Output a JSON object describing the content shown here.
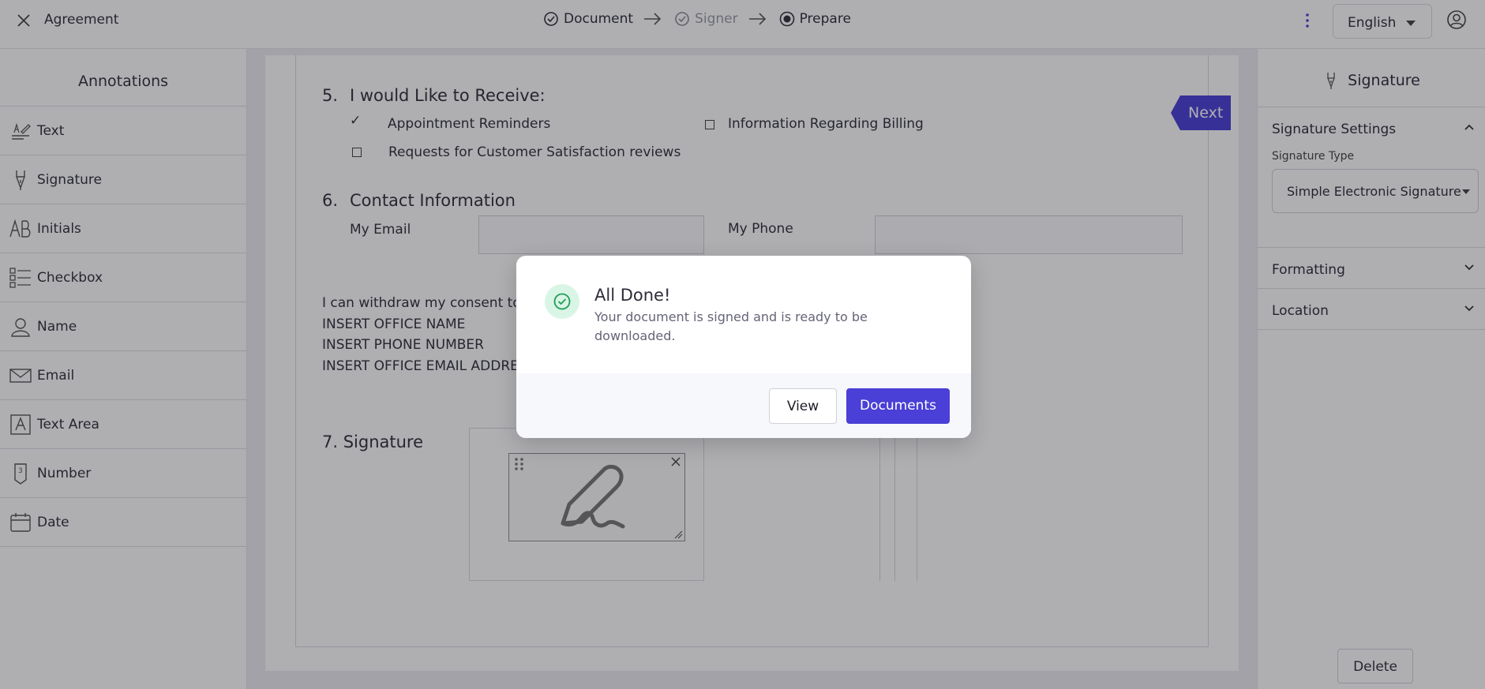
{
  "topbar": {
    "title": "Agreement",
    "steps": [
      {
        "label": "Document",
        "state": "done",
        "icon": "check-circle-icon"
      },
      {
        "label": "Signer",
        "state": "done-muted",
        "icon": "check-circle-icon"
      },
      {
        "label": "Prepare",
        "state": "current",
        "icon": "radio-dot-icon"
      }
    ],
    "language": "English"
  },
  "left_panel": {
    "title": "Annotations",
    "items": [
      {
        "label": "Text",
        "icon": "text-pen-icon"
      },
      {
        "label": "Signature",
        "icon": "pen-nib-icon"
      },
      {
        "label": "Initials",
        "icon": "initials-ab-icon"
      },
      {
        "label": "Checkbox",
        "icon": "checklist-icon"
      },
      {
        "label": "Name",
        "icon": "person-icon"
      },
      {
        "label": "Email",
        "icon": "envelope-icon"
      },
      {
        "label": "Text Area",
        "icon": "text-area-icon"
      },
      {
        "label": "Number",
        "icon": "number-tag-icon"
      },
      {
        "label": "Date",
        "icon": "calendar-icon"
      }
    ]
  },
  "document": {
    "sec5_num": "5.",
    "sec5_title": "I would Like to Receive:",
    "opt_appointment": "Appointment Reminders",
    "opt_billing": "Information Regarding Billing",
    "opt_surveys": "Requests for Customer Satisfaction reviews",
    "check_mark": "✓",
    "sec6_num": "6.",
    "sec6_title": "Contact Information",
    "email_label": "My Email",
    "phone_label": "My Phone",
    "consent_text": "I can withdraw my consent to ele",
    "office_name": "INSERT OFFICE NAME",
    "office_phone": "INSERT PHONE NUMBER",
    "office_email": "INSERT OFFICE EMAIL ADDRESS",
    "sec7_title": "7. Signature",
    "next_label": "Next"
  },
  "right_panel": {
    "title": "Signature",
    "settings_label": "Signature Settings",
    "signature_type_label": "Signature Type",
    "signature_type_value": "Simple Electronic Signature",
    "formatting_label": "Formatting",
    "location_label": "Location",
    "delete_label": "Delete"
  },
  "modal": {
    "title": "All Done!",
    "message": "Your document is signed and is ready to be downloaded.",
    "view_label": "View",
    "documents_label": "Documents"
  },
  "colors": {
    "accent": "#4a3fd6",
    "success_bg": "#d9f5e5",
    "success_fg": "#1f9d55"
  }
}
